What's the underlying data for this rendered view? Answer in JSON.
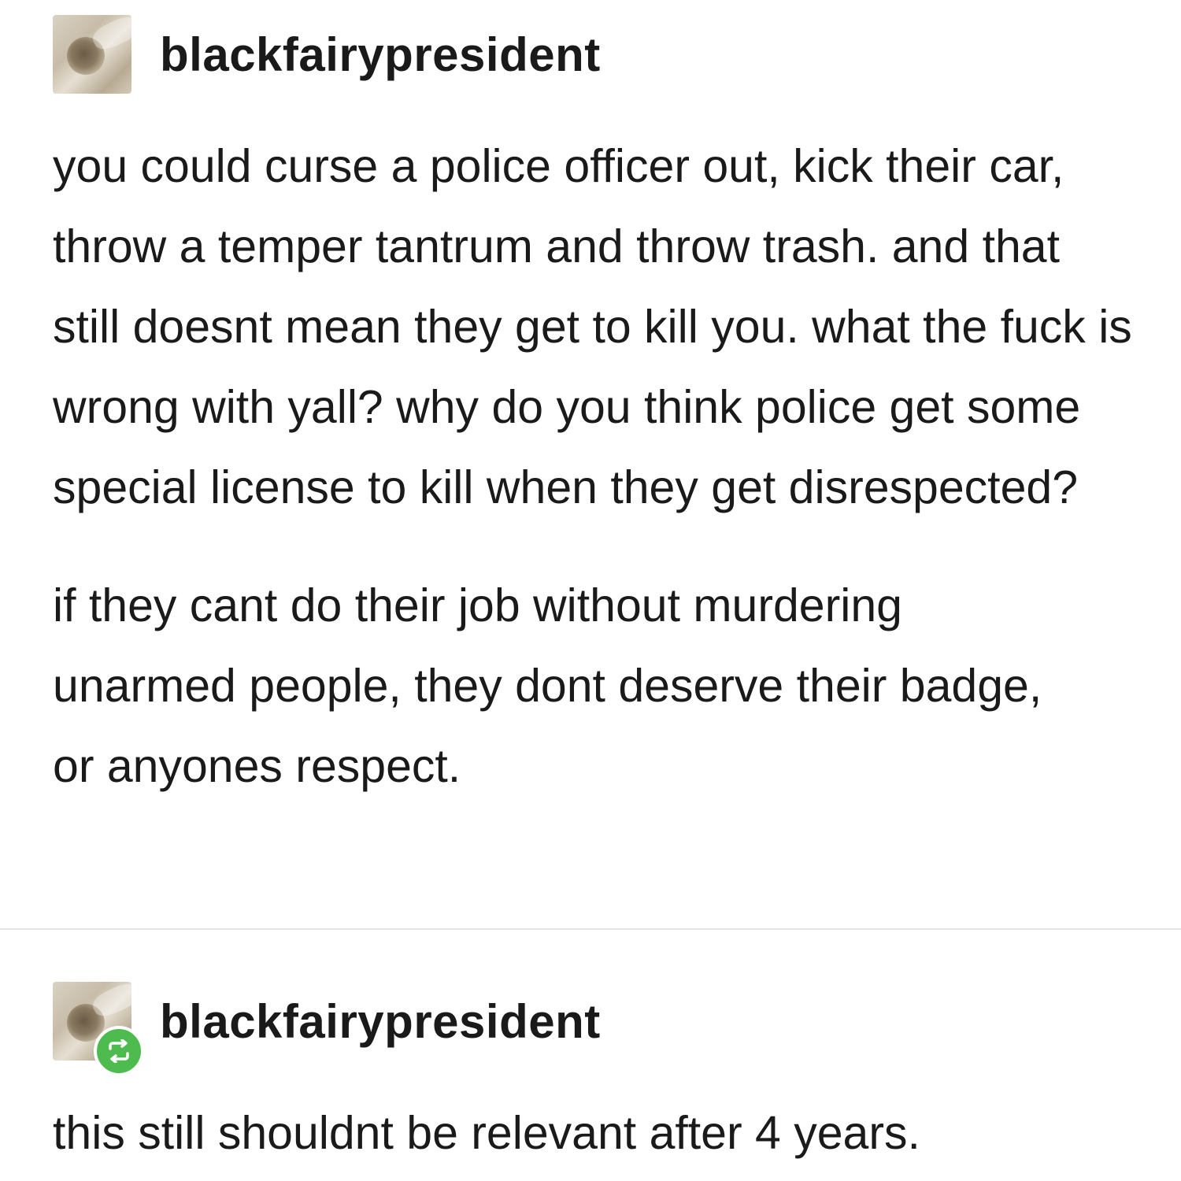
{
  "posts": [
    {
      "username": "blackfairypresident",
      "paragraphs": [
        "you could curse a police officer out, kick their car, throw a temper tantrum and throw trash. and that still doesnt mean they get to kill you. what the fuck is wrong with yall? why do you think police get some special license to kill when they get disrespected?",
        "if they cant do their job without murdering unarmed people, they dont deserve their badge, or anyones respect."
      ]
    },
    {
      "username": "blackfairypresident",
      "reblog_icon": "reblog-icon",
      "paragraphs": [
        "this still shouldnt be relevant after 4 years."
      ]
    }
  ],
  "colors": {
    "reblog_badge": "#4dbb4d",
    "text": "#1a1a1a",
    "divider": "#e3e3e3"
  }
}
